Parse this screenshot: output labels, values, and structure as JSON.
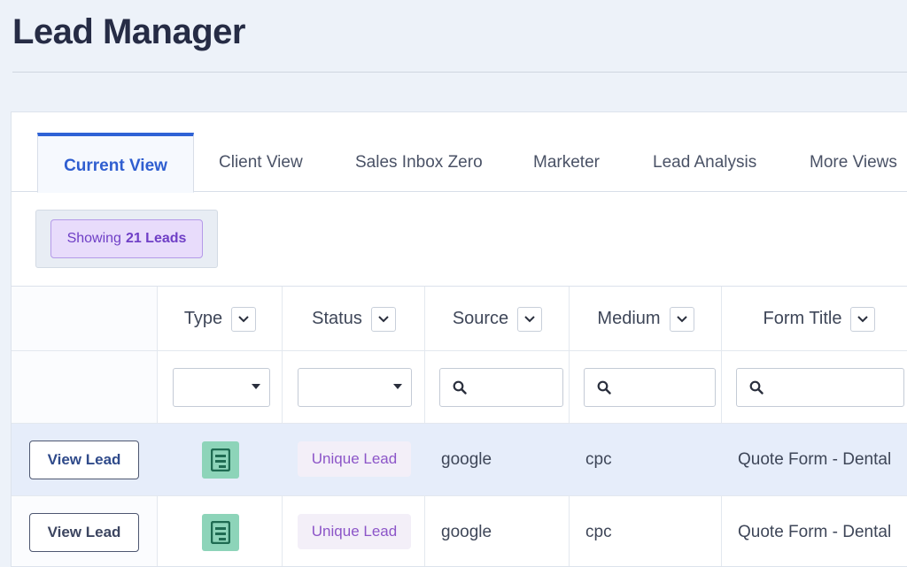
{
  "page": {
    "title": "Lead Manager"
  },
  "tabs": [
    {
      "label": "Current View",
      "active": true
    },
    {
      "label": "Client View"
    },
    {
      "label": "Sales Inbox Zero"
    },
    {
      "label": "Marketer"
    },
    {
      "label": "Lead Analysis"
    },
    {
      "label": "More Views"
    }
  ],
  "summary": {
    "prefix": "Showing",
    "count_label": "21 Leads"
  },
  "columns": [
    {
      "label": "Type",
      "filter": "select"
    },
    {
      "label": "Status",
      "filter": "select"
    },
    {
      "label": "Source",
      "filter": "search"
    },
    {
      "label": "Medium",
      "filter": "search"
    },
    {
      "label": "Form Title",
      "filter": "search"
    }
  ],
  "rows": [
    {
      "action": "View Lead",
      "type_icon": "form-icon",
      "status": "Unique Lead",
      "source": "google",
      "medium": "cpc",
      "form_title": "Quote Form - Dental",
      "highlighted": true
    },
    {
      "action": "View Lead",
      "type_icon": "form-icon",
      "status": "Unique Lead",
      "source": "google",
      "medium": "cpc",
      "form_title": "Quote Form - Dental",
      "highlighted": false
    }
  ],
  "colors": {
    "accent": "#2e62d6",
    "badge_bg": "#e8dcfb",
    "badge_text": "#6f3fc6",
    "status_text": "#8c55c8",
    "type_icon_bg": "#8dd4b9",
    "row_highlight": "#e6edfa"
  }
}
